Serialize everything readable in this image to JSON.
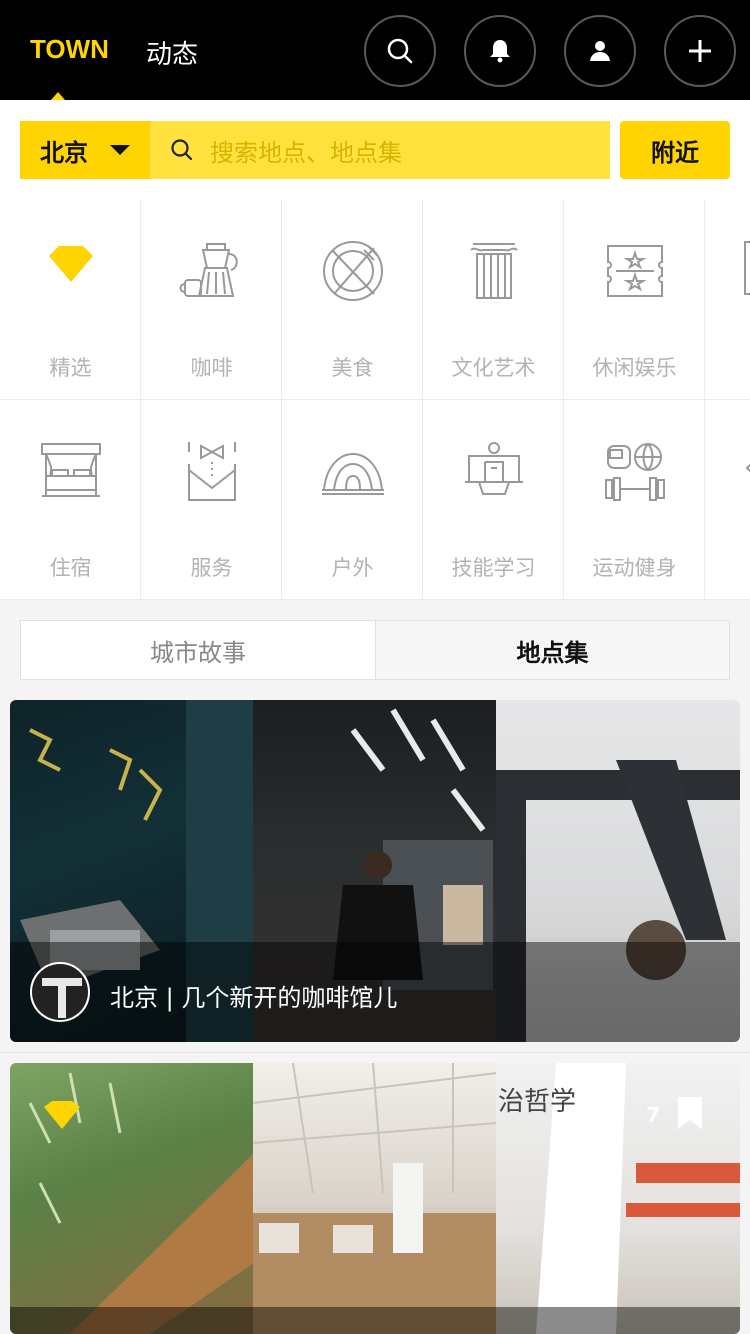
{
  "header": {
    "tabs": [
      {
        "label": "TOWN",
        "active": true
      },
      {
        "label": "动态",
        "active": false
      }
    ],
    "actions": [
      "search-icon",
      "bell-icon",
      "user-icon",
      "plus-icon"
    ]
  },
  "search": {
    "city": "北京",
    "placeholder": "搜索地点、地点集",
    "nearby_label": "附近"
  },
  "categories": {
    "row1": [
      "精选",
      "咖啡",
      "美食",
      "文化艺术",
      "休闲娱乐"
    ],
    "row2": [
      "住宿",
      "服务",
      "户外",
      "技能学习",
      "运动健身"
    ]
  },
  "segments": {
    "left": "城市故事",
    "right": "地点集",
    "active": "right"
  },
  "cards": [
    {
      "caption": "北京 | 几个新开的咖啡馆儿"
    },
    {
      "count": "7",
      "overlay_text": "治哲学"
    }
  ],
  "colors": {
    "accent": "#ffd400",
    "topbar": "#000000",
    "icon_gray": "#9a9a9a"
  }
}
